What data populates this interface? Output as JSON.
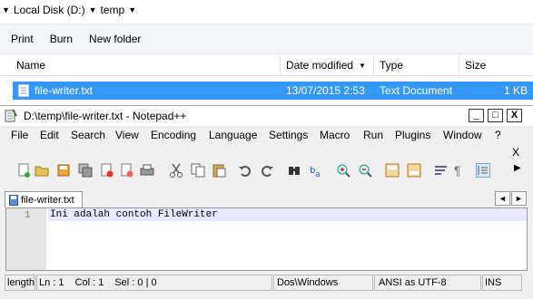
{
  "explorer": {
    "breadcrumb": [
      "Local Disk (D:)",
      "temp"
    ],
    "commands": [
      "Print",
      "Burn",
      "New folder"
    ],
    "columns": [
      "Name",
      "Date modified",
      "Type",
      "Size"
    ],
    "file": {
      "name": "file-writer.txt",
      "date": "13/07/2015 2:53",
      "type": "Text Document",
      "size": "1 KB"
    }
  },
  "npp": {
    "title": "D:\\temp\\file-writer.txt - Notepad++",
    "window_buttons": {
      "minimize": "_",
      "maximize": "□",
      "close": "X"
    },
    "menu": [
      "File",
      "Edit",
      "Search",
      "View",
      "Encoding",
      "Language",
      "Settings",
      "Macro",
      "Run",
      "Plugins",
      "Window",
      "?"
    ],
    "menu_close": "X",
    "tab": {
      "label": "file-writer.txt"
    },
    "tab_nav": {
      "left": "◄",
      "right": "►"
    },
    "editor": {
      "line_number": "1",
      "line_text": "Ini adalah contoh FileWriter"
    },
    "status": {
      "length": "length",
      "ln": "Ln : 1",
      "col": "Col : 1",
      "sel": "Sel : 0 | 0",
      "eol": "Dos\\Windows",
      "encoding": "ANSI as UTF-8",
      "mode": "INS"
    }
  }
}
